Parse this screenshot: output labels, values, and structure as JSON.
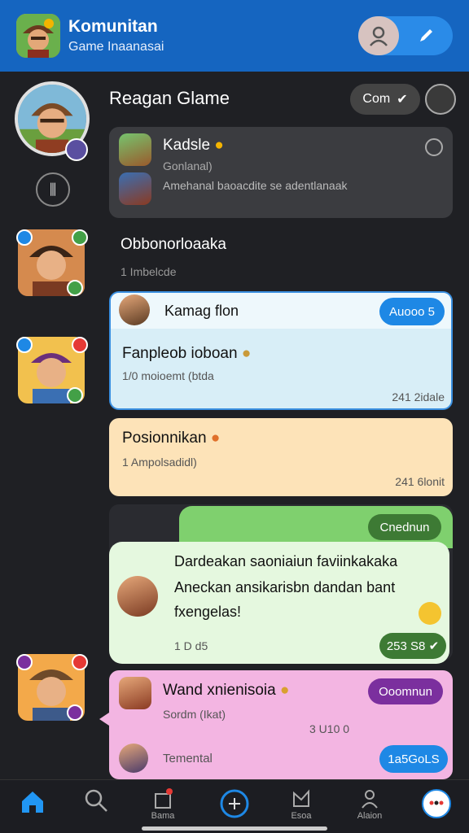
{
  "header": {
    "title": "Komunitan",
    "subtitle": "Game Inaanasai"
  },
  "section": {
    "title": "Reagan Glame",
    "com_button": "Com"
  },
  "pinned": {
    "name": "Kadsle",
    "sub": "Gonlanal)",
    "text": "Amehanal baoacdite se adentlanaak"
  },
  "conversation": {
    "title": "Obbonorloaaka",
    "sub": "1 Imbelcde"
  },
  "messages": [
    {
      "sender": "Kamag flon",
      "badge": "Auooo 5",
      "title": "Fanpleob ioboan",
      "sub": "1/0 moioemt (btda",
      "time": "241 2idale"
    },
    {
      "title": "Posionnikan",
      "sub": "1 Ampolsadidl)",
      "time": "241 6lonit"
    },
    {
      "badge": "Cnednun",
      "line1": "Dardeakan saoniaiun faviinkakaka",
      "line2": "Aneckan ansikarisbn dandan bant",
      "line3": "fxengelas!",
      "meta": "1 D d5",
      "time": "253 S8"
    },
    {
      "title": "Wand xnienisoia",
      "sub": "Sordm (Ikat)",
      "badge": "Ooomnun",
      "count": "3 U10 0",
      "footer_label": "Temental",
      "footer_button": "1a5GoLS"
    }
  ],
  "nav": {
    "items": [
      {
        "label": ""
      },
      {
        "label": ""
      },
      {
        "label": "Bama"
      },
      {
        "label": ""
      },
      {
        "label": "Esoa"
      },
      {
        "label": "Alaion"
      },
      {
        "label": ""
      }
    ]
  },
  "colors": {
    "header": "#1565c0",
    "accent_blue": "#1e88e5",
    "green_badge": "#3d7a34",
    "purple_badge": "#7b2f9e"
  }
}
